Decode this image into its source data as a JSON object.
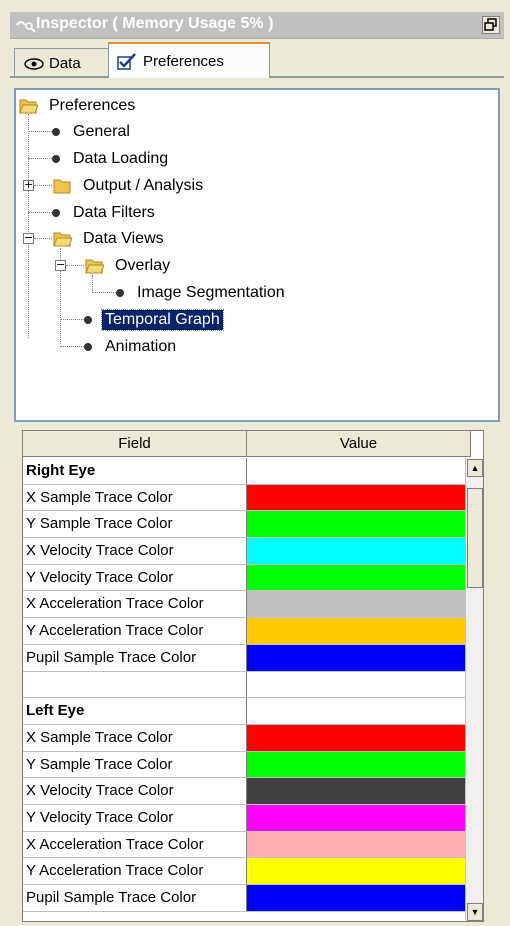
{
  "window": {
    "title": "Inspector ( Memory Usage 5% )",
    "title_icon": "eye-scope-icon",
    "restore_icon": "restore-window-icon"
  },
  "tabs": [
    {
      "label": "Data",
      "icon": "eye-icon",
      "active": false
    },
    {
      "label": "Preferences",
      "icon": "checkbox-icon",
      "active": true
    }
  ],
  "tree": {
    "root": "Preferences",
    "items": [
      {
        "label": "General",
        "type": "leaf"
      },
      {
        "label": "Data Loading",
        "type": "leaf"
      },
      {
        "label": "Output / Analysis",
        "type": "folder",
        "expanded": false
      },
      {
        "label": "Data Filters",
        "type": "leaf"
      },
      {
        "label": "Data Views",
        "type": "folder",
        "expanded": true
      },
      {
        "label": "Overlay",
        "type": "folder",
        "expanded": true
      },
      {
        "label": "Image Segmentation",
        "type": "leaf"
      },
      {
        "label": "Temporal Graph",
        "type": "leaf",
        "selected": true
      },
      {
        "label": "Animation",
        "type": "leaf"
      }
    ]
  },
  "grid": {
    "headers": {
      "field": "Field",
      "value": "Value"
    },
    "rows": [
      {
        "field": "Right Eye",
        "section": true,
        "color": ""
      },
      {
        "field": "X Sample Trace Color",
        "color": "#ff0000"
      },
      {
        "field": "Y Sample Trace Color",
        "color": "#00ff00"
      },
      {
        "field": "X Velocity Trace Color",
        "color": "#00ffff"
      },
      {
        "field": "Y Velocity Trace Color",
        "color": "#00ff00"
      },
      {
        "field": "X Acceleration Trace Color",
        "color": "#c0c0c0"
      },
      {
        "field": "Y Acceleration Trace Color",
        "color": "#ffc800"
      },
      {
        "field": "Pupil Sample Trace Color",
        "color": "#0000ff"
      },
      {
        "field": "",
        "color": ""
      },
      {
        "field": "Left Eye",
        "section": true,
        "color": ""
      },
      {
        "field": "X Sample Trace Color",
        "color": "#ff0000"
      },
      {
        "field": "Y Sample Trace Color",
        "color": "#00ff00"
      },
      {
        "field": "X Velocity Trace Color",
        "color": "#404040"
      },
      {
        "field": "Y Velocity Trace Color",
        "color": "#ff00ff"
      },
      {
        "field": "X Acceleration Trace Color",
        "color": "#ffafaf"
      },
      {
        "field": "Y Acceleration Trace Color",
        "color": "#ffff00"
      },
      {
        "field": "Pupil Sample Trace Color",
        "color": "#0000ff"
      }
    ]
  }
}
